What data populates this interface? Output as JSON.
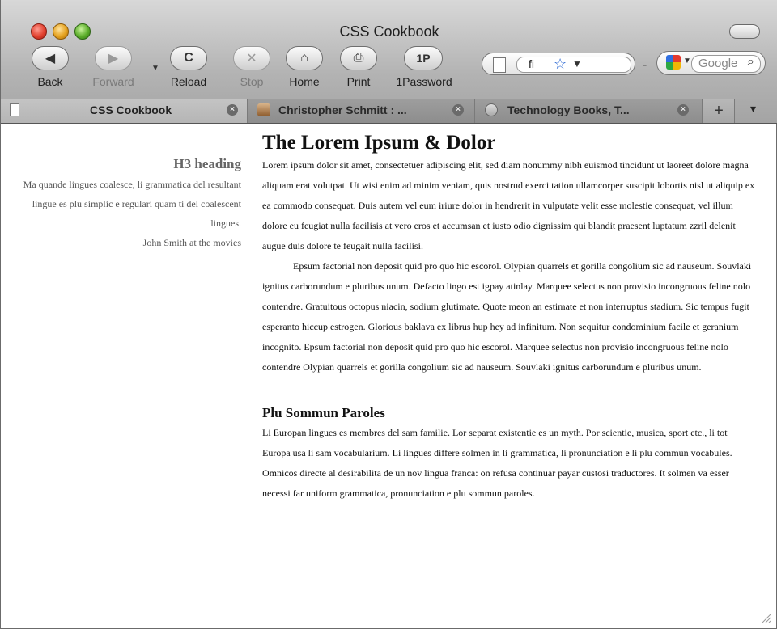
{
  "window": {
    "title": "CSS Cookbook"
  },
  "toolbar": {
    "back": "Back",
    "forward": "Forward",
    "reload": "Reload",
    "stop": "Stop",
    "home": "Home",
    "print": "Print",
    "onepassword": "1Password",
    "onepassword_icon": "1P"
  },
  "address": {
    "text": "fi"
  },
  "search": {
    "placeholder": "Google"
  },
  "tabs": [
    {
      "label": "CSS Cookbook",
      "icon": "document-icon",
      "active": true
    },
    {
      "label": "Christopher Schmitt : ...",
      "icon": "photo-favicon",
      "active": false
    },
    {
      "label": "Technology Books, T...",
      "icon": "globe-favicon",
      "active": false
    }
  ],
  "sidebar": {
    "heading": "H3 heading",
    "text": "Ma quande lingues coalesce, li grammatica del resultant lingue es plu simplic e regulari quam ti del coalescent lingues.",
    "caption": "John Smith at the movies"
  },
  "article": {
    "title": "The Lorem Ipsum & Dolor",
    "p1": "Lorem ipsum dolor sit amet, consectetuer adipiscing elit, sed diam nonummy nibh euismod tincidunt ut laoreet dolore magna aliquam erat volutpat. Ut wisi enim ad minim veniam, quis nostrud exerci tation ullamcorper suscipit lobortis nisl ut aliquip ex ea commodo consequat. Duis autem vel eum iriure dolor in hendrerit in vulputate velit esse molestie consequat, vel illum dolore eu feugiat nulla facilisis at vero eros et accumsan et iusto odio dignissim qui blandit praesent luptatum zzril delenit augue duis dolore te feugait nulla facilisi.",
    "p2": "Epsum factorial non deposit quid pro quo hic escorol. Olypian quarrels et gorilla congolium sic ad nauseum. Souvlaki ignitus carborundum e pluribus unum. Defacto lingo est igpay atinlay. Marquee selectus non provisio incongruous feline nolo contendre. Gratuitous octopus niacin, sodium glutimate. Quote meon an estimate et non interruptus stadium. Sic tempus fugit esperanto hiccup estrogen. Glorious baklava ex librus hup hey ad infinitum. Non sequitur condominium facile et geranium incognito. Epsum factorial non deposit quid pro quo hic escorol. Marquee selectus non provisio incongruous feline nolo contendre Olypian quarrels et gorilla congolium sic ad nauseum. Souvlaki ignitus carborundum e pluribus unum.",
    "subheading": "Plu Sommun Paroles",
    "p3": "Li Europan lingues es membres del sam familie. Lor separat existentie es un myth. Por scientie, musica, sport etc., li tot Europa usa li sam vocabularium. Li lingues differe solmen in li grammatica, li pronunciation e li plu commun vocabules. Omnicos directe al desirabilita de un nov lingua franca: on refusa continuar payar custosi traductores. It solmen va esser necessi far uniform grammatica, pronunciation e plu sommun paroles."
  }
}
